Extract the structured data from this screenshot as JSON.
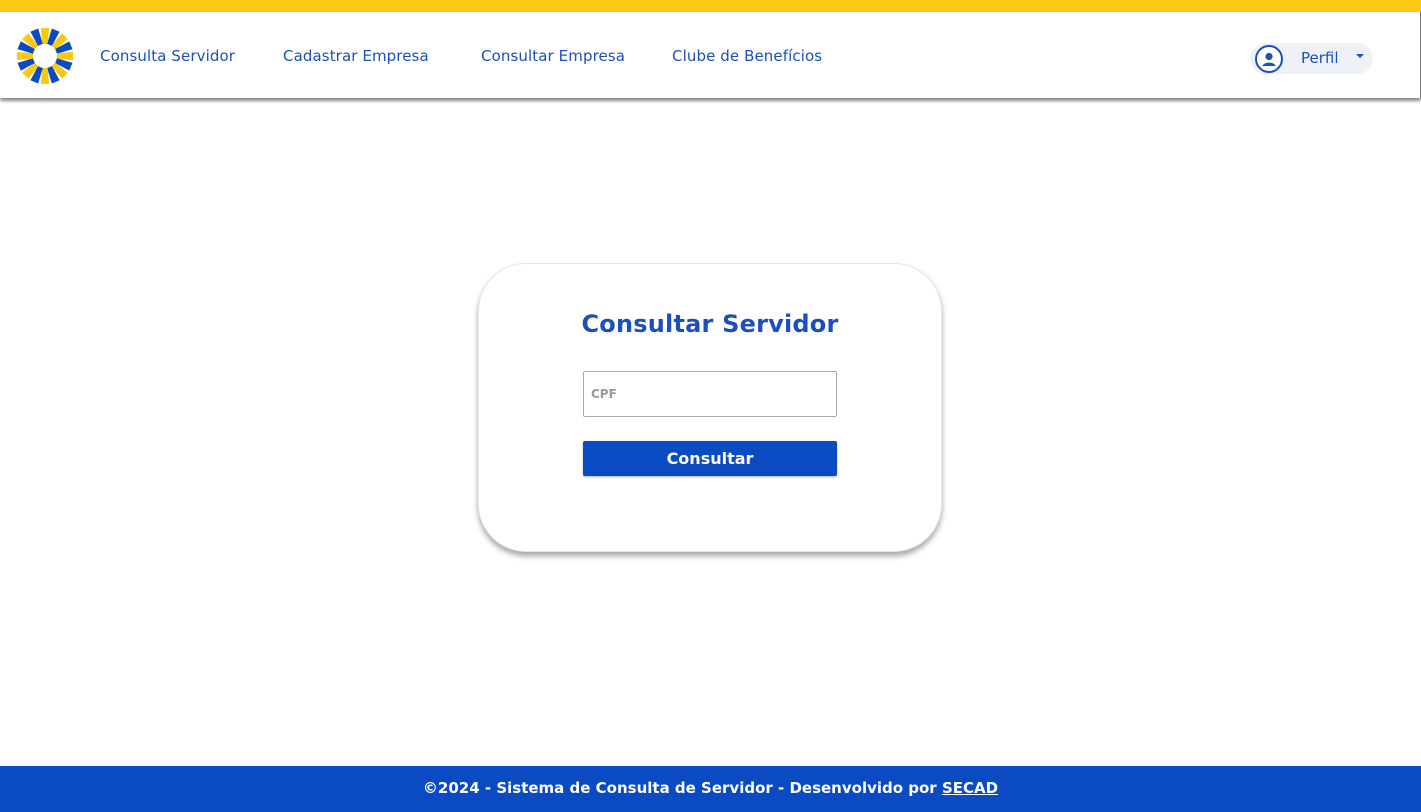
{
  "brand": {
    "colors": {
      "yellow": "#fcc813",
      "blue": "#0a4bc4",
      "link_blue": "#1a4fbf"
    },
    "logo_icon": "sunburst-logo-icon"
  },
  "nav": {
    "items": [
      {
        "label": "Consulta Servidor"
      },
      {
        "label": "Cadastrar Empresa"
      },
      {
        "label": "Consultar Empresa"
      },
      {
        "label": "Clube de Benefícios"
      }
    ]
  },
  "profile": {
    "label": "Perfil",
    "icon": "user-icon",
    "caret_icon": "caret-down-icon"
  },
  "card": {
    "title": "Consultar Servidor",
    "cpf_placeholder": "CPF",
    "cpf_value": "",
    "button_label": "Consultar"
  },
  "footer": {
    "text": "©2024 - Sistema de Consulta de Servidor - Desenvolvido por ",
    "link_label": "SECAD"
  }
}
